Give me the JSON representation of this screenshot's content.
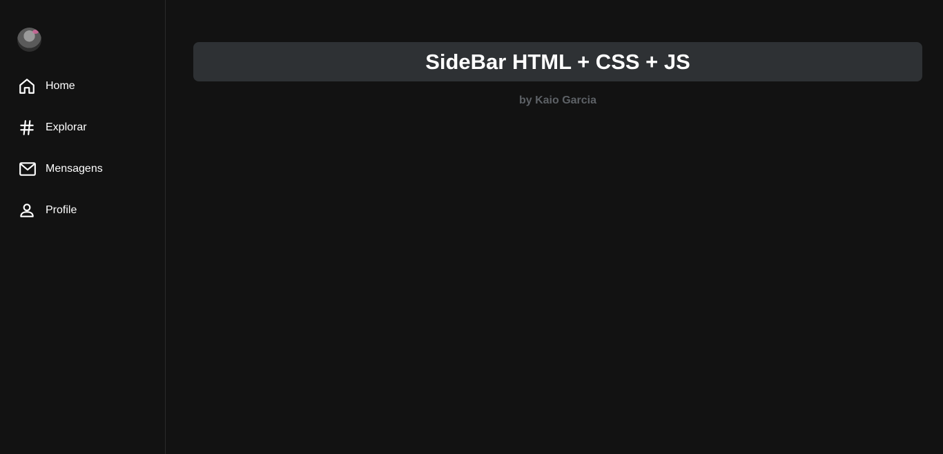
{
  "sidebar": {
    "avatar_icon": "user-photo",
    "items": [
      {
        "label": "Home",
        "icon": "home-icon"
      },
      {
        "label": "Explorar",
        "icon": "hash-icon"
      },
      {
        "label": "Mensagens",
        "icon": "mail-icon"
      },
      {
        "label": "Profile",
        "icon": "user-icon"
      }
    ]
  },
  "main": {
    "title": "SideBar HTML + CSS + JS",
    "byline": "by Kaio Garcia"
  },
  "colors": {
    "background": "#121212",
    "title_bar": "#2e3134",
    "text": "#ffffff",
    "byline": "#5d6166"
  }
}
